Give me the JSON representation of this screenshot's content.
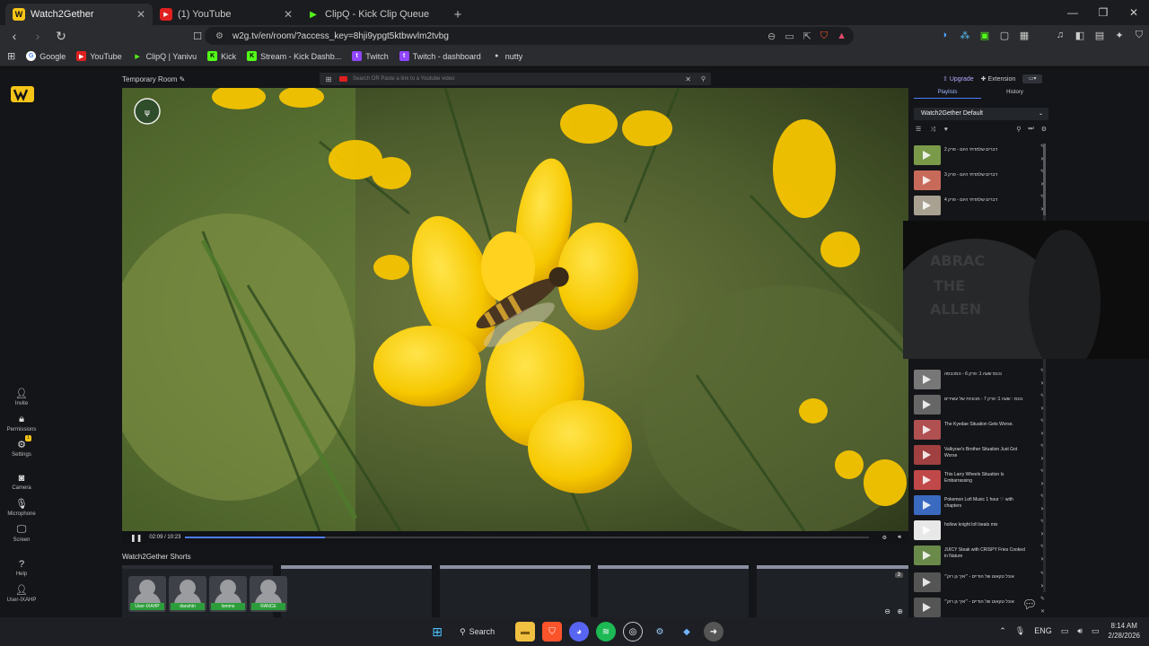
{
  "browser": {
    "tabs": [
      {
        "title": "Watch2Gether",
        "active": true,
        "icon": "w2g"
      },
      {
        "title": "(1) YouTube",
        "active": false,
        "icon": "youtube"
      },
      {
        "title": "ClipQ - Kick Clip Queue",
        "active": false,
        "icon": "clipq"
      }
    ],
    "url": "w2g.tv/en/room/?access_key=8hji9ypgt5ktbwvlm2tvbg",
    "bookmarks": [
      "Google",
      "YouTube",
      "ClipQ | Yanivu",
      "Kick",
      "Stream - Kick Dashb...",
      "Twitch",
      "Twitch - dashboard",
      "nutty"
    ]
  },
  "room": {
    "title": "Temporary Room",
    "search_placeholder": "Search OR Paste a link to a Youtube video",
    "time": "02:09 / 10:23",
    "progress_fraction": 0.205,
    "shorts_title": "Watch2Gether Shorts",
    "shorts_count_badge": "3"
  },
  "rail": {
    "invite": "Invite",
    "permissions": "Permissions",
    "settings": "Settings",
    "settings_badge": "1",
    "camera": "Camera",
    "microphone": "Microphone",
    "screen": "Screen",
    "help": "Help",
    "user": "User-IXAHP"
  },
  "users": [
    "User-IXAHP",
    "danshin",
    "lomms",
    "RANCE"
  ],
  "panel": {
    "upgrade": "Upgrade",
    "extension": "Extension",
    "tab_playlists": "Playlists",
    "tab_history": "History",
    "playlist_name": "Watch2Gether Default",
    "items": [
      {
        "title": "דברים שלמדתי היום - פרק 2"
      },
      {
        "title": "דברים שלמדתי היום - פרק 3"
      },
      {
        "title": "דברים שלמדתי היום - פרק 4"
      },
      {
        "title": "נכנס שעה 1: פרק 6 - המכבסה"
      },
      {
        "title": "נכנס : שעה 1: פרק 7 - מכוניות של עשירים"
      },
      {
        "title": "The Kyedae Situation Gets Worse."
      },
      {
        "title": "Valkyrae's Brother Situation Just Got Worse"
      },
      {
        "title": "This Larry Wheels Situation Is Embarrassing"
      },
      {
        "title": "Pokemon Lofi Music 1 hour ♡ with chapters"
      },
      {
        "title": "hollow knight lofi beats mix"
      },
      {
        "title": "JUICY Steak with CRISPY Fries Cooked in Nature"
      },
      {
        "title": "אוכל טקאוט של הודיים - ״איך גן רוק״"
      },
      {
        "title": "אוכל טקאוט של הודיים - ״איך גן רוק״"
      }
    ]
  },
  "taskbar": {
    "search": "Search",
    "lang": "ENG",
    "time": "8:14 AM",
    "date": "2/28/2026"
  },
  "colors": {
    "accent": "#4d7dff",
    "user_badge": "#2c9d3a",
    "upgrade": "#b7a6ff"
  }
}
